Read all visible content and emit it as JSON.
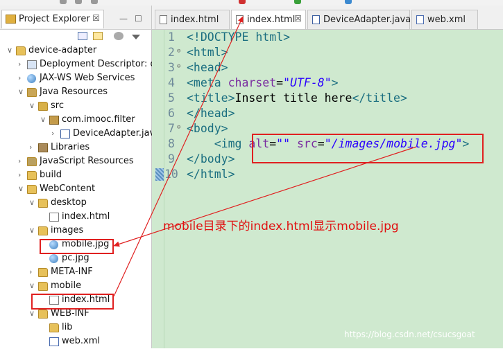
{
  "explorer": {
    "tab_label": "Project Explorer",
    "tab_close": "☒",
    "minimize": "—",
    "maximize": "☐",
    "tree": [
      {
        "label": "device-adapter",
        "arrow": "∨",
        "icon": "project-icon"
      },
      {
        "label": "Deployment Descriptor: de",
        "arrow": "›",
        "icon": "descriptor-icon"
      },
      {
        "label": "JAX-WS Web Services",
        "arrow": "›",
        "icon": "webservice-icon"
      },
      {
        "label": "Java Resources",
        "arrow": "∨",
        "icon": "java-resources-icon"
      },
      {
        "label": "src",
        "arrow": "∨",
        "icon": "source-folder-icon"
      },
      {
        "label": "com.imooc.filter",
        "arrow": "∨",
        "icon": "package-icon"
      },
      {
        "label": "DeviceAdapter.java",
        "arrow": "›",
        "icon": "java-file-icon"
      },
      {
        "label": "Libraries",
        "arrow": "›",
        "icon": "library-icon"
      },
      {
        "label": "JavaScript Resources",
        "arrow": "›",
        "icon": "js-resources-icon"
      },
      {
        "label": "build",
        "arrow": "›",
        "icon": "folder-icon"
      },
      {
        "label": "WebContent",
        "arrow": "∨",
        "icon": "folder-icon"
      },
      {
        "label": "desktop",
        "arrow": "∨",
        "icon": "folder-icon"
      },
      {
        "label": "index.html",
        "arrow": "",
        "icon": "html-file-icon"
      },
      {
        "label": "images",
        "arrow": "∨",
        "icon": "folder-icon"
      },
      {
        "label": "mobile.jpg",
        "arrow": "",
        "icon": "image-file-icon"
      },
      {
        "label": "pc.jpg",
        "arrow": "",
        "icon": "image-file-icon"
      },
      {
        "label": "META-INF",
        "arrow": "›",
        "icon": "folder-icon"
      },
      {
        "label": "mobile",
        "arrow": "∨",
        "icon": "folder-icon"
      },
      {
        "label": "index.html",
        "arrow": "",
        "icon": "html-file-icon"
      },
      {
        "label": "WEB-INF",
        "arrow": "∨",
        "icon": "folder-icon"
      },
      {
        "label": "lib",
        "arrow": "",
        "icon": "folder-icon"
      },
      {
        "label": "web.xml",
        "arrow": "",
        "icon": "xml-file-icon"
      }
    ]
  },
  "editor": {
    "tabs": [
      {
        "label": "index.html",
        "active": false,
        "close": ""
      },
      {
        "label": "index.html",
        "active": true,
        "close": "☒"
      },
      {
        "label": "DeviceAdapter.java",
        "active": false,
        "close": ""
      },
      {
        "label": "web.xml",
        "active": false,
        "close": ""
      }
    ],
    "line_numbers": [
      "1",
      "2",
      "3",
      "4",
      "5",
      "6",
      "7",
      "8",
      "9",
      "10"
    ],
    "fold_marker": "⊖",
    "code": {
      "l1_a": "<!DOCTYPE html>",
      "l2_a": "<html>",
      "l3_a": "<head>",
      "l4_a": "<meta",
      "l4_b": " charset",
      "l4_c": "=",
      "l4_d": "\"UTF-8\"",
      "l4_e": ">",
      "l5_a": "<title>",
      "l5_b": "Insert title here",
      "l5_c": "</title>",
      "l6_a": "</head>",
      "l7_a": "<body>",
      "l8_a": "    <img",
      "l8_b": " alt",
      "l8_c": "=",
      "l8_d": "\"\"",
      "l8_e": " src",
      "l8_f": "=",
      "l8_g": "\"/images/mobile.jpg\"",
      "l8_h": ">",
      "l9_a": "</body>",
      "l10_a": "</html>"
    }
  },
  "annotation": "mobile目录下的index.html显示mobile.jpg",
  "watermark": "https://blog.csdn.net/csucsgoat",
  "colors": {
    "highlight": "#e02020",
    "editor_bg": "#cfe9cf",
    "tag": "#1a6e80",
    "attr": "#7a2da0",
    "string": "#2a00ff"
  }
}
